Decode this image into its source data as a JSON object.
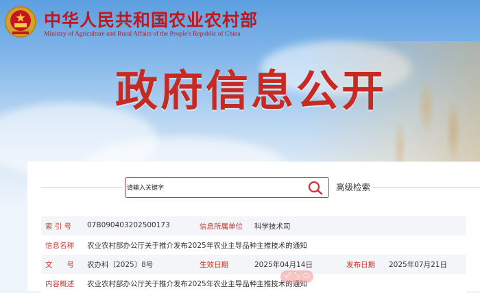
{
  "header": {
    "ministry_cn": "中华人民共和国农业农村部",
    "ministry_en": "Ministry of Agriculture and Rural Affairs of the People's Republic of China",
    "section_title": "政府信息公开"
  },
  "search": {
    "placeholder": "请输入关键字",
    "advanced_label": "高级检索"
  },
  "info": {
    "index_label": "索 引 号",
    "index_value": "07B090403202500173",
    "dept_label": "信息所属单位",
    "dept_value": "科学技术司",
    "name_label": "信息名称",
    "name_value": "农业农村部办公厅关于推介发布2025年农业主导品种主推技术的通知",
    "docno_label": "文　　号",
    "docno_value": "农办科〔2025〕8号",
    "effective_label": "生效日期",
    "effective_value": "2025年04月14日",
    "publish_label": "发布日期",
    "publish_value": "2025年07月21日",
    "summary_label": "内容概述",
    "summary_value": "农业农村部办公厅关于推介发布2025年农业主导品种主推技术的通知"
  },
  "colors": {
    "brand_red": "#c0161c",
    "label_red": "#c8352b",
    "row_bg": "#f3f5f8"
  }
}
